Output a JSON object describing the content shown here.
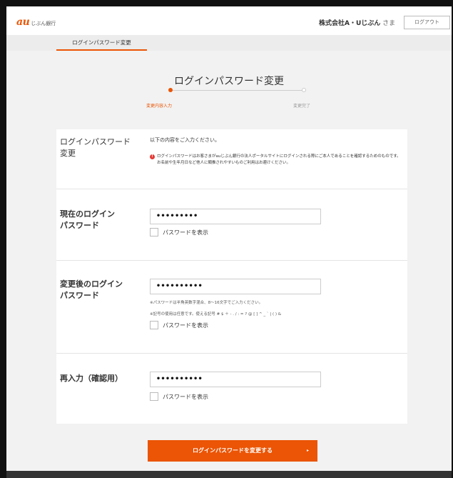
{
  "colors": {
    "accent": "#eb5505",
    "error": "#e53935"
  },
  "header": {
    "logo_mark": "au",
    "logo_text": "じぶん銀行",
    "user_name": "株式会社A・Uじぶん",
    "user_suffix": "さま",
    "logout_label": "ログアウト"
  },
  "tabs": {
    "active": "ログインパスワード変更"
  },
  "page": {
    "title": "ログインパスワード変更",
    "steps": [
      "変更内容入力",
      "変更完了"
    ],
    "current_step": 1
  },
  "form": {
    "section1": {
      "label_line1": "ログインパスワード",
      "label_line2": "変更",
      "intro": "以下の内容をご入力ください。",
      "notice_icon": "!",
      "notice": "ログインパスワードはお客さまがauじぶん銀行の法人ポータルサイトにログインされる際にご本人であることを確認するためのものです。お名前や生年月日など他人に類推されやすいものご利用はお避けください。"
    },
    "current": {
      "label_line1": "現在のログイン",
      "label_line2": "パスワード",
      "value": "•••••••••",
      "show_label": "パスワードを表示"
    },
    "new": {
      "label_line1": "変更後のログイン",
      "label_line2": "パスワード",
      "value": "••••••••••",
      "hint1": "※パスワードは半角英数字混合、8〜16文字でご入力ください。",
      "hint2": "※記号の使用は任意です。使える記号 # $ ＋ - . / : = ? @ [ ] ^ _ ` | ( ) &",
      "show_label": "パスワードを表示"
    },
    "confirm": {
      "label": "再入力（確認用）",
      "value": "••••••••••",
      "show_label": "パスワードを表示"
    }
  },
  "submit": {
    "label": "ログインパスワードを変更する",
    "arrow": "▸"
  }
}
